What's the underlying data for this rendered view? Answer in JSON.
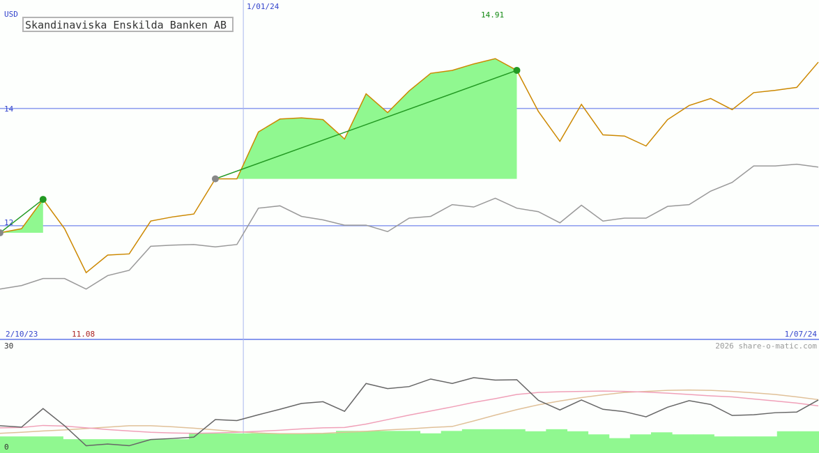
{
  "chart_data": [
    {
      "type": "line",
      "title": "Skandinaviska Enskilda Banken AB",
      "currency_label": "USD",
      "y_ticks": [
        12,
        14
      ],
      "ylim": [
        10.05,
        15.85
      ],
      "date_labels": {
        "start": "2/10/23",
        "mid": "1/01/24",
        "end": "1/07/24"
      },
      "high_label": "14.91",
      "low_label": "11.08",
      "colors": {
        "price": "#cc8800",
        "compare": "#999999",
        "fill": "#90f890",
        "trend": "#229922",
        "grid": "#8899ee"
      },
      "series": [
        {
          "id": "price",
          "values": [
            11.88,
            11.95,
            12.45,
            11.95,
            11.2,
            11.5,
            11.52,
            12.08,
            12.15,
            12.2,
            12.8,
            12.8,
            13.6,
            13.82,
            13.84,
            13.81,
            13.48,
            14.25,
            13.93,
            14.3,
            14.6,
            14.65,
            14.76,
            14.85,
            14.65,
            13.95,
            13.44,
            14.07,
            13.55,
            13.53,
            13.36,
            13.81,
            14.05,
            14.17,
            13.98,
            14.27,
            14.31,
            14.36,
            14.79
          ]
        },
        {
          "id": "compare",
          "values": [
            10.92,
            10.98,
            11.1,
            11.1,
            10.92,
            11.15,
            11.24,
            11.65,
            11.67,
            11.68,
            11.64,
            11.68,
            12.3,
            12.34,
            12.16,
            12.1,
            12.01,
            12.01,
            11.9,
            12.13,
            12.16,
            12.36,
            12.32,
            12.47,
            12.3,
            12.24,
            12.05,
            12.35,
            12.08,
            12.13,
            12.13,
            12.33,
            12.36,
            12.59,
            12.74,
            13.02,
            13.02,
            13.05,
            13.0
          ]
        }
      ],
      "highlights": [
        {
          "from": 0,
          "to": 2
        },
        {
          "from": 10,
          "to": 24
        }
      ]
    },
    {
      "type": "line",
      "ylim": [
        0,
        30
      ],
      "y_ticks": [
        0,
        30
      ],
      "watermark": "2026 share-o-matic.com",
      "series": [
        {
          "id": "indicator",
          "color": "#666666",
          "values": [
            6.5,
            6.1,
            11.5,
            6.5,
            0.7,
            1.2,
            0.7,
            2.5,
            2.8,
            3.2,
            8.3,
            8.0,
            9.7,
            11.3,
            13.0,
            13.5,
            10.7,
            18.8,
            17.3,
            17.9,
            20.1,
            18.8,
            20.5,
            19.8,
            19.9,
            13.9,
            11.1,
            14.0,
            11.3,
            10.6,
            9.1,
            11.9,
            13.8,
            12.7,
            9.5,
            9.7,
            10.3,
            10.5,
            14.0
          ]
        },
        {
          "id": "avg-fast",
          "color": "#f0a0b8",
          "values": [
            5.9,
            6.0,
            6.6,
            6.4,
            5.9,
            5.4,
            5.0,
            4.6,
            4.4,
            4.3,
            4.4,
            4.6,
            4.9,
            5.2,
            5.6,
            5.9,
            6.0,
            7.0,
            8.3,
            9.6,
            10.8,
            12.0,
            13.3,
            14.4,
            15.6,
            16.2,
            16.4,
            16.5,
            16.6,
            16.5,
            16.3,
            16.0,
            15.6,
            15.2,
            14.9,
            14.3,
            13.7,
            13.1,
            12.3
          ]
        },
        {
          "id": "avg-slow",
          "color": "#e0c098",
          "values": [
            4.3,
            4.6,
            5.0,
            5.3,
            5.7,
            6.1,
            6.5,
            6.5,
            6.2,
            5.8,
            5.3,
            4.8,
            4.4,
            4.2,
            4.2,
            4.3,
            4.6,
            4.9,
            5.3,
            5.6,
            6.0,
            6.3,
            7.9,
            9.6,
            11.2,
            12.6,
            13.7,
            14.7,
            15.5,
            16.2,
            16.5,
            16.8,
            16.9,
            16.8,
            16.5,
            16.1,
            15.6,
            14.9,
            14.1
          ]
        },
        {
          "id": "volume",
          "color": "#90f890",
          "values": [
            3.4,
            3.4,
            3.4,
            2.6,
            2.6,
            2.6,
            2.6,
            2.6,
            2.6,
            4.3,
            4.3,
            4.3,
            4.3,
            4.3,
            4.3,
            4.3,
            5.0,
            5.0,
            5.0,
            5.0,
            4.3,
            5.0,
            5.5,
            5.5,
            5.5,
            4.9,
            5.5,
            4.9,
            4.0,
            2.9,
            4.0,
            4.6,
            4.0,
            4.0,
            3.4,
            3.4,
            3.4,
            4.9,
            4.9
          ]
        }
      ]
    }
  ]
}
